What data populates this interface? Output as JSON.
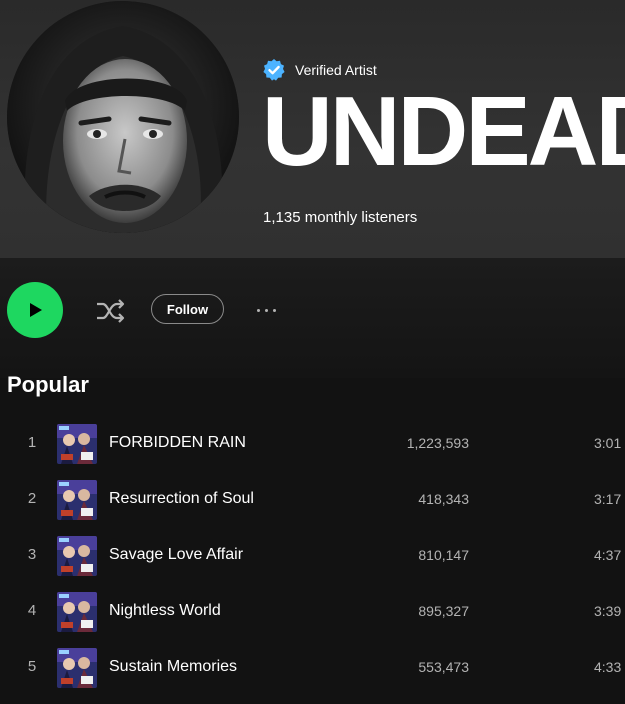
{
  "artist": {
    "verified_label": "Verified Artist",
    "name": "UNDEAD",
    "monthly_listeners": "1,135 monthly listeners"
  },
  "controls": {
    "play_icon": "play-icon",
    "shuffle_icon": "shuffle-icon",
    "follow_label": "Follow",
    "more_icon": "more-options-icon"
  },
  "popular": {
    "title": "Popular",
    "tracks": [
      {
        "num": "1",
        "title": "FORBIDDEN RAIN",
        "plays": "1,223,593",
        "duration": "3:01"
      },
      {
        "num": "2",
        "title": "Resurrection of Soul",
        "plays": "418,343",
        "duration": "3:17"
      },
      {
        "num": "3",
        "title": "Savage Love Affair",
        "plays": "810,147",
        "duration": "4:37"
      },
      {
        "num": "4",
        "title": "Nightless World",
        "plays": "895,327",
        "duration": "3:39"
      },
      {
        "num": "5",
        "title": "Sustain Memories",
        "plays": "553,473",
        "duration": "4:33"
      }
    ]
  },
  "colors": {
    "accent": "#1ed760",
    "verified": "#4cb3ff",
    "background": "#121212",
    "secondary_text": "#b3b3b3"
  }
}
